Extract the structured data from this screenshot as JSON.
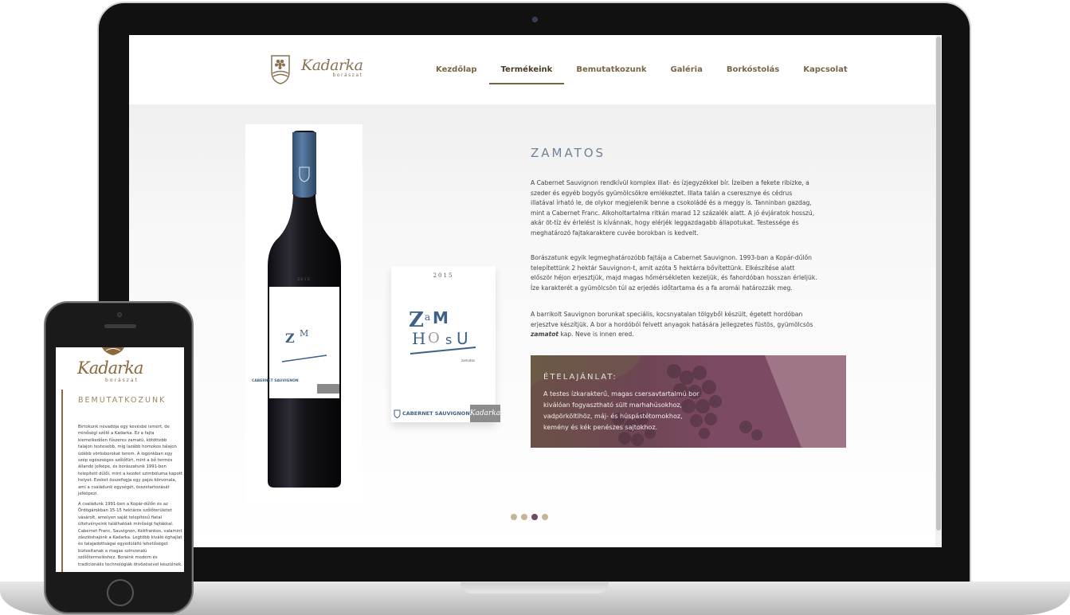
{
  "site": {
    "logo_text": "Kadarka",
    "logo_sub": "borászat"
  },
  "nav": {
    "items": [
      {
        "label": "Kezdőlap"
      },
      {
        "label": "Termékeink"
      },
      {
        "label": "Bemutatkozunk"
      },
      {
        "label": "Galéria"
      },
      {
        "label": "Borkóstolás"
      },
      {
        "label": "Kapcsolat"
      }
    ],
    "active_index": 1
  },
  "product": {
    "title": "ZAMATOS",
    "year": "2015",
    "brand_line": "CABERNET SAUVIGNON",
    "label_small": "zamatos",
    "paragraphs": [
      "A Cabernet Sauvignon rendkívül komplex illat- és ízjegyzékkel bír. Ízeiben a fekete ribizke, a szeder és egyéb bogyós gyümölcsökre emlékeztet. Illata talán a cseresznye és cédrus illatával írható le, de olykor megjelenik benne a csokoládé és a meggy is. Tanninban gazdag, mint a Cabernet Franc. Alkoholtartalma ritkán marad 12 százalék alatt. A jó évjáratok hosszú, akár öt-tíz év érlelést is kívánnak, hogy elérjék leggazdagabb állapotukat. Testessége és meghatározó fajtakaraktere cuvée borokban is kedvelt.",
      "Borászatunk egyik legmeghatározóbb fajtája a Cabernet Sauvignon. 1993-ban a Kopár-dűlőn telepítettünk 2 hektár Sauvignon-t, amit azóta 5 hektárra bővítettünk. Elkészítése alatt először héjon erjesztjük, majd magas hőmérsékleten kezeljük, és fahordóban hosszan érleljük. Íze karakterét a gyümölcsön túl az erjedés időtartama és a fa aromái határozzák meg."
    ],
    "p3_before": "A barrikolt Sauvignon borunkat speciális, kocsnyatalan tölgyből készült, égetett hordóban erjesztve készítjük. A bor a hordóból felvett anyagok hatására jellegzetes füstös, gyümölcsös ",
    "p3_em": "zamatot",
    "p3_after": " kap. Neve is innen ered.",
    "food": {
      "title": "ÉTELAJÁNLAT:",
      "text": "A testes ízkarakterű, magas csersavtartalmú bor kiválóan fogyasztható sült marhahúsokhoz, vadpörköltihöz, máj- és húspástétomokhoz, kemény és kék penészes sajtokhoz."
    }
  },
  "carousel": {
    "count": 4,
    "active": 2
  },
  "mobile": {
    "logo_text": "Kadarka",
    "logo_sub": "borászat",
    "heading": "BEMUTATKOZUNK",
    "paragraphs": [
      "Birtokunk névadója egy kevésbé ismert, de minőségi szőlő a Kadarka. Ez a fajta kiemelkedően fűszeres zamatú, kötöttebb talajon testesebb, míg lazább homokos talajon üdébb vörösborokat terem. A logónkban egy szép egészséges szőlőfürt, mint a bő termés állandó jelképe, és borászatunk 1991-ben telepített dűlői, mint a kezdet szimbóluma kapott helyet. Ezeket összefogja egy pajzs körvonala, ami a családunk egységét, összetartozását jelképezi.",
      "A családunk 1991-ben a Kopár-dűlőn és az Ördögárokban 15-15 hektáros szőlőterületet vásárolt, amelyen saját telepítésű fiatal ültetvényeink találhatóak minőségi fajtákkal. Cabernet Franc, Sauvignon, Kékfrankos, valamint zászlóshajónk a Kadarka. Legtöbb kiváló éghajlat és talajadottságai egyedülálló lehetőséget biztosítanak a magas színvonalú szőlőtermeléshez. Boraink modern és tradicionális technológiák ötvözésével készülnek."
    ]
  },
  "colors": {
    "accent_brown": "#7a6446",
    "title_blue": "#6f8298",
    "food_bg": "#7d4a63",
    "dot": "#c5b597",
    "dot_active": "#6e4c5a"
  }
}
